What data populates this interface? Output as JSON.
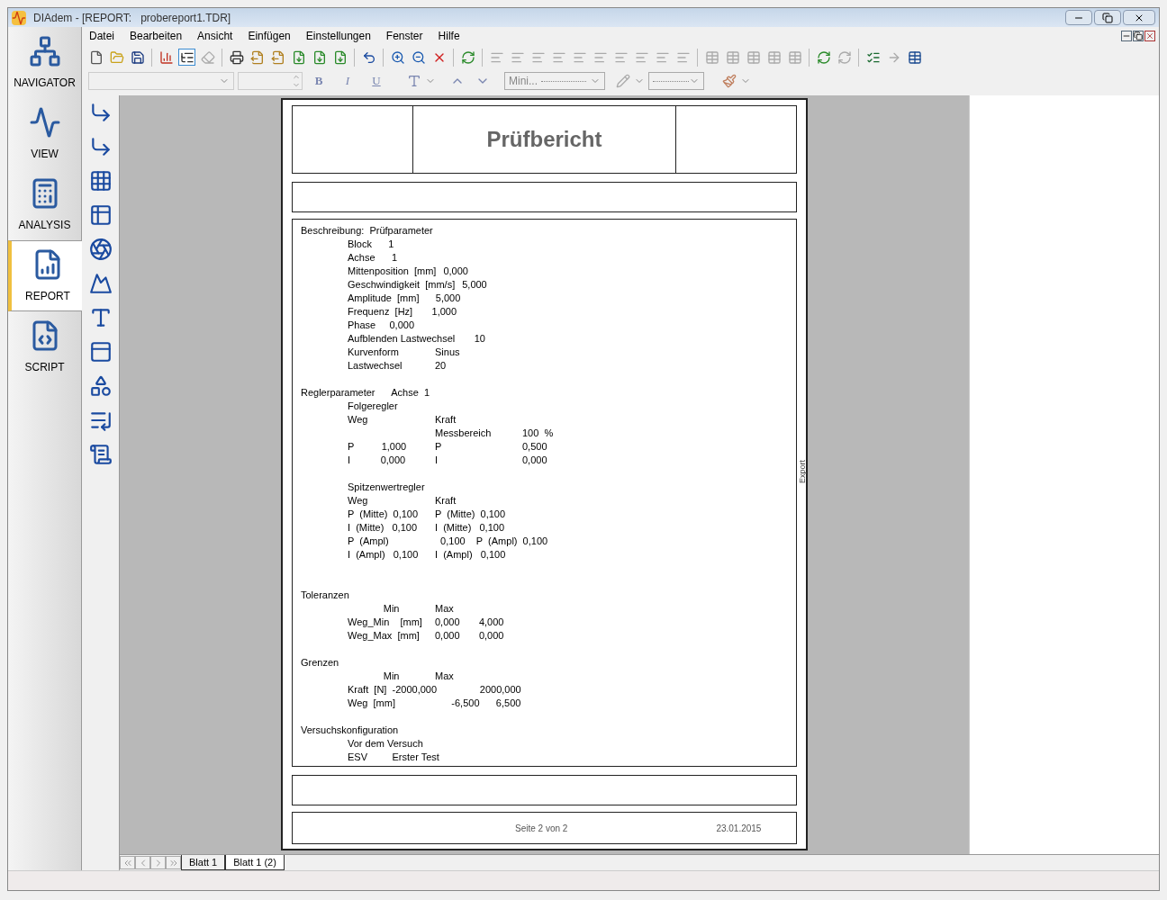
{
  "window": {
    "title": "DIAdem - [REPORT:   probereport1.TDR]"
  },
  "menu": [
    "Datei",
    "Bearbeiten",
    "Ansicht",
    "Einfügen",
    "Einstellungen",
    "Fenster",
    "Hilfe"
  ],
  "toolbar": [
    {
      "kind": "new",
      "disabled": false
    },
    {
      "kind": "open",
      "disabled": false
    },
    {
      "kind": "save",
      "disabled": false
    },
    {
      "kind": "sep"
    },
    {
      "kind": "chart",
      "disabled": false
    },
    {
      "kind": "tree",
      "disabled": false,
      "selected": true
    },
    {
      "kind": "eraser",
      "disabled": true
    },
    {
      "kind": "sep"
    },
    {
      "kind": "print",
      "disabled": false
    },
    {
      "kind": "export",
      "disabled": false
    },
    {
      "kind": "export",
      "disabled": false
    },
    {
      "kind": "file",
      "disabled": false
    },
    {
      "kind": "file",
      "disabled": false
    },
    {
      "kind": "file",
      "disabled": false
    },
    {
      "kind": "sep"
    },
    {
      "kind": "undo",
      "disabled": false
    },
    {
      "kind": "sep"
    },
    {
      "kind": "zoomin",
      "disabled": false
    },
    {
      "kind": "zoomout",
      "disabled": false
    },
    {
      "kind": "cancel",
      "disabled": false
    },
    {
      "kind": "sep"
    },
    {
      "kind": "refresh",
      "disabled": false
    },
    {
      "kind": "sep"
    },
    {
      "kind": "align",
      "disabled": true
    },
    {
      "kind": "align",
      "disabled": true
    },
    {
      "kind": "align",
      "disabled": true
    },
    {
      "kind": "align",
      "disabled": true
    },
    {
      "kind": "align",
      "disabled": true
    },
    {
      "kind": "align",
      "disabled": true
    },
    {
      "kind": "align",
      "disabled": true
    },
    {
      "kind": "align",
      "disabled": true
    },
    {
      "kind": "align",
      "disabled": true
    },
    {
      "kind": "align",
      "disabled": true
    },
    {
      "kind": "sep"
    },
    {
      "kind": "table",
      "disabled": true
    },
    {
      "kind": "table",
      "disabled": true
    },
    {
      "kind": "table",
      "disabled": true
    },
    {
      "kind": "table",
      "disabled": true
    },
    {
      "kind": "table",
      "disabled": true
    },
    {
      "kind": "sep"
    },
    {
      "kind": "refresh",
      "disabled": false
    },
    {
      "kind": "refresh",
      "disabled": true
    },
    {
      "kind": "sep"
    },
    {
      "kind": "list",
      "disabled": false
    },
    {
      "kind": "arrow",
      "disabled": true
    },
    {
      "kind": "table",
      "disabled": false
    }
  ],
  "format_bar": {
    "bold": "B",
    "italic": "I",
    "underline": "U",
    "line_width": "Mini..."
  },
  "navigator": [
    {
      "label": "NAVIGATOR",
      "selected": false
    },
    {
      "label": "VIEW",
      "selected": false
    },
    {
      "label": "ANALYSIS",
      "selected": false
    },
    {
      "label": "REPORT",
      "selected": true
    },
    {
      "label": "SCRIPT",
      "selected": false
    }
  ],
  "report": {
    "title": "Prüfbericht",
    "side_label": "Export",
    "lines": [
      {
        "kind": "heading",
        "cells": [
          "Beschreibung:  Prüfparameter"
        ]
      },
      {
        "kind": "item",
        "cells": [
          "Block      1"
        ]
      },
      {
        "kind": "item",
        "cells": [
          "Achse      1"
        ]
      },
      {
        "kind": "item",
        "cells": [
          "Mittenposition  [mm]",
          "0,000"
        ]
      },
      {
        "kind": "item",
        "cells": [
          "Geschwindigkeit  [mm/s]",
          "5,000"
        ]
      },
      {
        "kind": "item",
        "cells": [
          "Amplitude  [mm]      5,000"
        ]
      },
      {
        "kind": "item",
        "cells": [
          "Frequenz  [Hz]       1,000"
        ]
      },
      {
        "kind": "item",
        "cells": [
          "Phase     0,000"
        ]
      },
      {
        "kind": "item",
        "cells": [
          "Aufblenden Lastwechsel       10"
        ]
      },
      {
        "kind": "item",
        "cells": [
          "Kurvenform",
          "Sinus"
        ]
      },
      {
        "kind": "item",
        "cells": [
          "Lastwechsel",
          "20"
        ]
      },
      {
        "kind": "gap"
      },
      {
        "kind": "heading",
        "cells": [
          "Reglerparameter      Achse  1"
        ]
      },
      {
        "kind": "item",
        "cells": [
          "Folgeregler"
        ]
      },
      {
        "kind": "item",
        "cells": [
          "Weg",
          "Kraft"
        ]
      },
      {
        "kind": "item",
        "cells": [
          "",
          "Messbereich",
          "100  %"
        ]
      },
      {
        "kind": "item",
        "cells": [
          "P          1,000",
          "P",
          "0,500"
        ]
      },
      {
        "kind": "item",
        "cells": [
          "I           0,000",
          "I",
          "0,000"
        ]
      },
      {
        "kind": "gap"
      },
      {
        "kind": "item",
        "cells": [
          "Spitzenwertregler"
        ]
      },
      {
        "kind": "item",
        "cells": [
          "Weg",
          "Kraft"
        ]
      },
      {
        "kind": "item",
        "cells": [
          "P  (Mitte)  0,100",
          "P  (Mitte)  0,100"
        ]
      },
      {
        "kind": "item",
        "cells": [
          "I  (Mitte)   0,100",
          "I  (Mitte)   0,100"
        ]
      },
      {
        "kind": "item",
        "cells": [
          "P  (Ampl)",
          "  0,100    P  (Ampl)  0,100"
        ]
      },
      {
        "kind": "item",
        "cells": [
          "I  (Ampl)   0,100",
          "I  (Ampl)   0,100"
        ]
      },
      {
        "kind": "gap"
      },
      {
        "kind": "gap"
      },
      {
        "kind": "heading",
        "cells": [
          "Toleranzen"
        ]
      },
      {
        "kind": "item",
        "cells": [
          "             Min",
          "Max"
        ]
      },
      {
        "kind": "item",
        "cells": [
          "Weg_Min    [mm]",
          "0,000       4,000"
        ]
      },
      {
        "kind": "item",
        "cells": [
          "Weg_Max  [mm]",
          "0,000       0,000"
        ]
      },
      {
        "kind": "gap"
      },
      {
        "kind": "heading",
        "cells": [
          "Grenzen"
        ]
      },
      {
        "kind": "item",
        "cells": [
          "             Min",
          "Max"
        ]
      },
      {
        "kind": "item",
        "cells": [
          "Kraft  [N]  -2000,000",
          "             2000,000"
        ]
      },
      {
        "kind": "item",
        "cells": [
          "Weg  [mm]",
          "      -6,500      6,500"
        ]
      },
      {
        "kind": "gap"
      },
      {
        "kind": "heading",
        "cells": [
          "Versuchskonfiguration"
        ]
      },
      {
        "kind": "item",
        "cells": [
          "Vor dem Versuch"
        ]
      },
      {
        "kind": "item",
        "cells": [
          "ESV         Erster Test"
        ]
      }
    ],
    "footer": {
      "page": "Seite 2 von 2",
      "date": "23.01.2015"
    }
  },
  "sheets": [
    {
      "label": "Blatt 1",
      "selected": false
    },
    {
      "label": "Blatt 1 (2)",
      "selected": true
    }
  ]
}
